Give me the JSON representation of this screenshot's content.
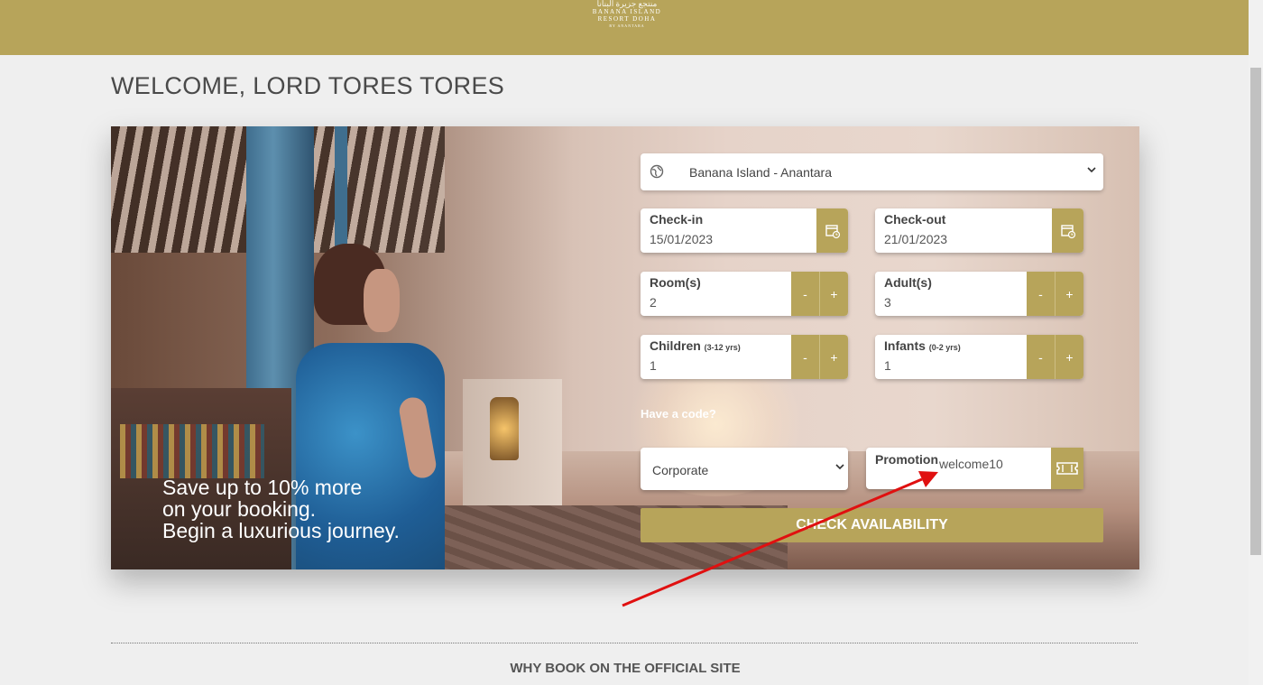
{
  "header": {
    "logo_arabic": "منتجع جزيرة البنانا",
    "logo_line1": "BANANA ISLAND",
    "logo_line2": "RESORT DOHA",
    "logo_line3": "BY ANANTARA",
    "bg_color": "#b7a45a"
  },
  "welcome": "WELCOME, LORD TORES TORES",
  "hero": {
    "tagline": [
      "Save up to 10% more",
      "on your booking.",
      "Begin a luxurious journey."
    ]
  },
  "booking": {
    "hotel": {
      "icon": "globe-icon",
      "value": "Banana Island - Anantara"
    },
    "checkin": {
      "label": "Check-in",
      "value": "15/01/2023",
      "icon": "calendar-icon"
    },
    "checkout": {
      "label": "Check-out",
      "value": "21/01/2023",
      "icon": "calendar-icon"
    },
    "rooms": {
      "label": "Room(s)",
      "value": "2"
    },
    "adults": {
      "label": "Adult(s)",
      "value": "3"
    },
    "children": {
      "label": "Children",
      "sub": "(3-12 yrs)",
      "value": "1"
    },
    "infants": {
      "label": "Infants",
      "sub": "(0-2 yrs)",
      "value": "1"
    },
    "minus": "-",
    "plus": "+",
    "have_code": "Have a code?",
    "code_type": "Corporate",
    "promotion_label": "Promotion",
    "promotion_value": "welcome10",
    "cta": "CHECK AVAILABILITY"
  },
  "why_title": "WHY BOOK ON THE OFFICIAL SITE",
  "colors": {
    "accent": "#b7a45a",
    "annotation": "#e01010"
  }
}
